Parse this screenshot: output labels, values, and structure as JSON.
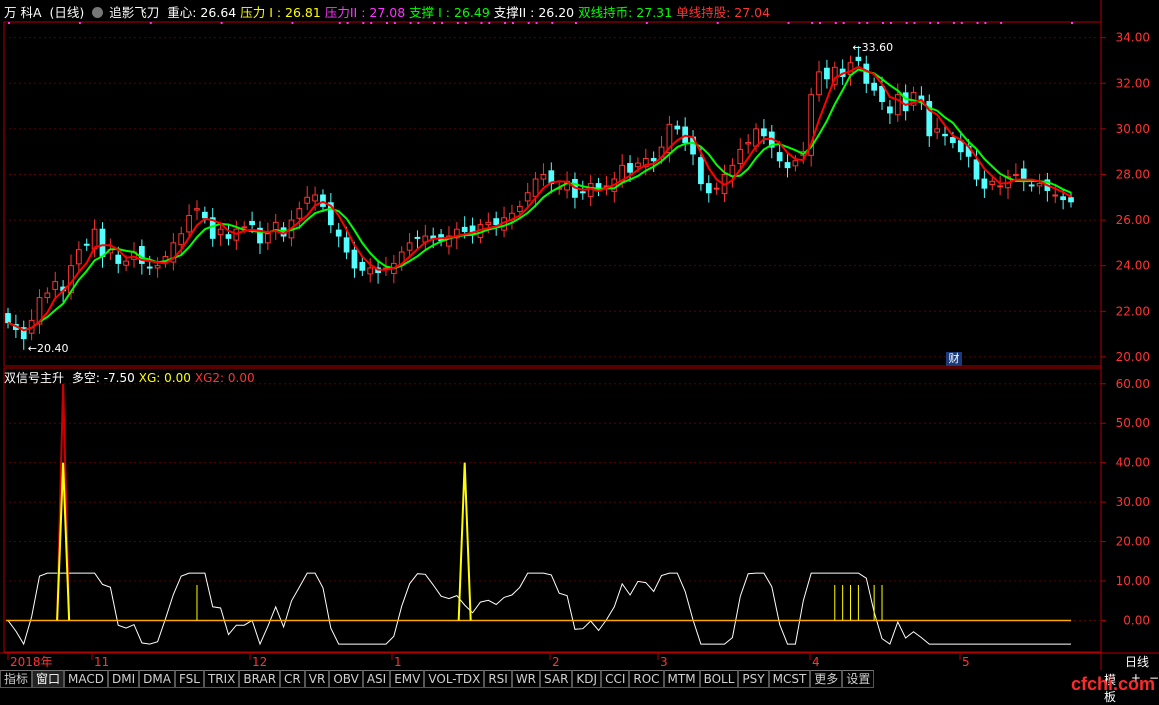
{
  "header": {
    "stock": "万 科A",
    "period": "(日线)",
    "indicator_icon": "circle-dropdown-icon",
    "indicator": "追影飞刀",
    "items": [
      {
        "label": "重心: 26.64",
        "color": "#ffffff"
      },
      {
        "label": "压力 I : 26.81",
        "color": "#ffff00"
      },
      {
        "label": "压力II : 27.08",
        "color": "#ff33ff"
      },
      {
        "label": "支撑 I : 26.49",
        "color": "#00ff00"
      },
      {
        "label": "支撑II : 26.20",
        "color": "#ffffff"
      },
      {
        "label": "双线持币: 27.31",
        "color": "#00ff00"
      },
      {
        "label": "单线持股: 27.04",
        "color": "#ff3333"
      }
    ]
  },
  "price_axis": {
    "ticks": [
      "34.00",
      "32.00",
      "30.00",
      "28.00",
      "26.00",
      "24.00",
      "22.00",
      "20.00"
    ],
    "min_label": "←20.40",
    "max_label": "←33.60"
  },
  "badge": "财",
  "sub_header": {
    "title": "双信号主升",
    "items": [
      {
        "label": "多空: -7.50",
        "color": "#ffffff"
      },
      {
        "label": "XG: 0.00",
        "color": "#ffff00"
      },
      {
        "label": "XG2: 0.00",
        "color": "#ff3333"
      }
    ]
  },
  "sub_axis": {
    "ticks": [
      "60.00",
      "50.00",
      "40.00",
      "30.00",
      "20.00",
      "10.00",
      "0.00"
    ]
  },
  "date_axis": [
    "2018年",
    "11",
    "12",
    "1",
    "2",
    "3",
    "4",
    "5"
  ],
  "period_label": "日线",
  "tabs": [
    "指标",
    "窗口",
    "MACD",
    "DMI",
    "DMA",
    "FSL",
    "TRIX",
    "BRAR",
    "CR",
    "VR",
    "OBV",
    "ASI",
    "EMV",
    "VOL-TDX",
    "RSI",
    "WR",
    "SAR",
    "KDJ",
    "CCI",
    "ROC",
    "MTM",
    "BOLL",
    "PSY",
    "MCST",
    "更多",
    "设置"
  ],
  "template_label": "模板",
  "controls": [
    "+",
    "−"
  ],
  "watermark": "cfchi.com",
  "colors": {
    "up": "#ff3232",
    "down": "#54ffff",
    "ma_red": "#ff0000",
    "ma_green": "#00ff00",
    "axis": "#b00000",
    "signal": "#ffff00",
    "dk": "#ffffff"
  },
  "chart_data": {
    "type": "candlestick",
    "price_range": [
      19.6,
      34.6
    ],
    "closes": [
      21.5,
      21.2,
      20.8,
      21.6,
      22.6,
      22.8,
      23.3,
      22.9,
      24.0,
      24.7,
      24.9,
      25.6,
      24.4,
      24.7,
      24.1,
      24.2,
      24.6,
      24.1,
      23.9,
      24.0,
      24.4,
      25.0,
      25.4,
      26.2,
      26.5,
      26.1,
      25.2,
      25.6,
      25.2,
      25.6,
      25.7,
      25.8,
      25.0,
      25.4,
      25.9,
      25.3,
      26.0,
      26.5,
      27.0,
      27.1,
      26.6,
      25.8,
      25.3,
      24.6,
      23.9,
      23.8,
      23.9,
      23.7,
      23.9,
      24.1,
      24.6,
      25.0,
      25.2,
      25.3,
      25.2,
      25.1,
      25.3,
      25.6,
      25.5,
      25.4,
      25.8,
      25.9,
      25.8,
      26.1,
      26.3,
      26.6,
      27.2,
      27.8,
      28.0,
      27.6,
      27.4,
      27.7,
      27.0,
      27.2,
      27.6,
      27.3,
      27.5,
      27.8,
      28.4,
      28.1,
      28.5,
      28.7,
      28.6,
      29.2,
      30.2,
      30.0,
      29.4,
      28.9,
      27.6,
      27.2,
      27.4,
      28.0,
      28.4,
      29.1,
      29.4,
      30.0,
      29.7,
      29.2,
      28.6,
      28.3,
      28.6,
      29.0,
      31.5,
      32.5,
      32.2,
      32.7,
      32.3,
      32.9,
      33.0,
      32.0,
      31.7,
      31.2,
      30.7,
      31.5,
      30.8,
      31.6,
      31.2,
      29.7,
      30.0,
      29.7,
      29.4,
      29.0,
      28.8,
      27.8,
      27.4,
      27.7,
      27.5,
      27.9,
      28.0,
      27.7,
      27.5,
      27.6,
      27.3,
      27.1,
      26.9,
      26.8
    ],
    "range_labels": {
      "min": 20.4,
      "max": 33.6
    },
    "indicator": {
      "name": "双信号主升",
      "ylim": [
        -8,
        64
      ],
      "dk_last": -7.5,
      "xg_last": 0.0,
      "xg2_last": 0.0
    }
  }
}
